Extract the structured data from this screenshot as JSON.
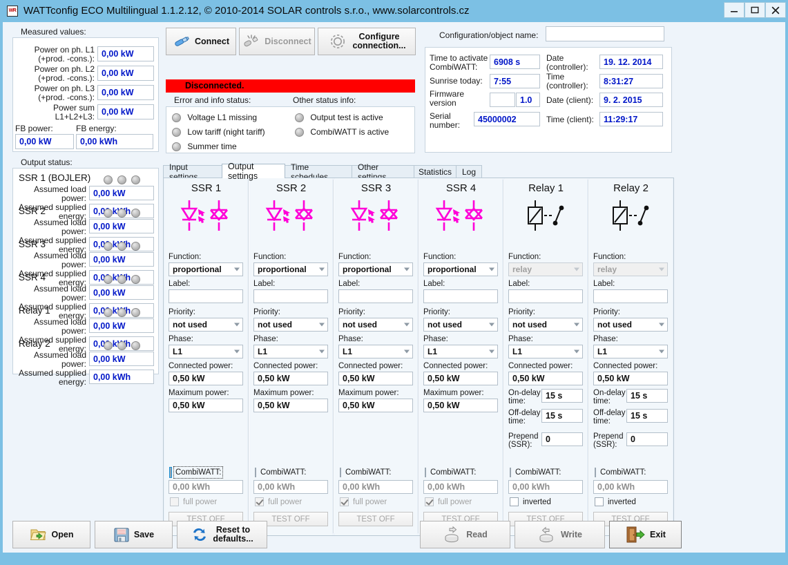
{
  "window": {
    "title": "WATTconfig ECO Multilingual 1.1.2.12, © 2010-2014 SOLAR controls s.r.o., www.solarcontrols.cz",
    "icon_text": "WR",
    "minimize": "—",
    "maximize": "▢",
    "close": "✕"
  },
  "measured": {
    "group_label": "Measured values:",
    "rows": [
      {
        "label1": "Power on ph. L1",
        "label2": "(+prod. -cons.):",
        "value": "0,00 kW"
      },
      {
        "label1": "Power on ph. L2",
        "label2": "(+prod. -cons.):",
        "value": "0,00 kW"
      },
      {
        "label1": "Power on ph. L3",
        "label2": "(+prod. -cons.):",
        "value": "0,00 kW"
      },
      {
        "label1": "Power sum",
        "label2": "L1+L2+L3:",
        "value": "0,00 kW"
      }
    ],
    "fb_power_label": "FB power:",
    "fb_power_value": "0,00 kW",
    "fb_energy_label": "FB energy:",
    "fb_energy_value": "0,00 kWh"
  },
  "connection": {
    "connect": "Connect",
    "disconnect": "Disconnect",
    "configure": "Configure\nconnection...",
    "configure_line1": "Configure",
    "configure_line2": "connection...",
    "status_text": "Disconnected.",
    "status_color": "#ff0000"
  },
  "status": {
    "error_label": "Error and info status:",
    "other_label": "Other status info:",
    "error_items": [
      "Voltage L1 missing",
      "Low tariff (night tariff)",
      "Summer time"
    ],
    "other_items": [
      "Output test is active",
      "CombiWATT is active"
    ]
  },
  "config": {
    "name_label": "Configuration/object name:",
    "name_value": "",
    "fields": [
      {
        "label1": "Time to activate",
        "label2": "CombiWATT:",
        "value": "6908 s"
      },
      {
        "label1": "Sunrise today:",
        "label2": "",
        "value": "7:55"
      },
      {
        "label1": "Firmware",
        "label2": "version",
        "value": "",
        "value2": "1.0"
      },
      {
        "label1": "Serial",
        "label2": "number:",
        "value": "45000002"
      }
    ],
    "right_fields": [
      {
        "label1": "Date",
        "label2": "(controller):",
        "value": "19. 12. 2014"
      },
      {
        "label1": "Time",
        "label2": "(controller):",
        "value": "8:31:27"
      },
      {
        "label1": "Date (client):",
        "label2": "",
        "value": "9. 2. 2015"
      },
      {
        "label1": "Time (client):",
        "label2": "",
        "value": "11:29:17"
      }
    ]
  },
  "output_status": {
    "group_label": "Output status:",
    "load_power_label1": "Assumed load",
    "load_power_label2": "power:",
    "supplied_label1": "Assumed supplied",
    "supplied_label2": "energy:",
    "items": [
      {
        "name": "SSR 1 (BOJLER)",
        "load_power": "0,00 kW",
        "supplied_energy": "0,00 kWh",
        "leds": 4
      },
      {
        "name": "SSR 2",
        "load_power": "0,00 kW",
        "supplied_energy": "0,00 kWh",
        "leds": 4
      },
      {
        "name": "SSR 3",
        "load_power": "0,00 kW",
        "supplied_energy": "0,00 kWh",
        "leds": 4
      },
      {
        "name": "SSR 4",
        "load_power": "0,00 kW",
        "supplied_energy": "0,00 kWh",
        "leds": 4
      },
      {
        "name": "Relay 1",
        "load_power": "0,00 kW",
        "supplied_energy": "0,00 kWh",
        "leds": 4
      },
      {
        "name": "Relay 2",
        "load_power": "0,00 kW",
        "supplied_energy": "0,00 kWh",
        "leds": 4
      }
    ]
  },
  "tabs": {
    "items": [
      "Input settings",
      "Output settings",
      "Time schedules",
      "Other settings",
      "Statistics",
      "Log"
    ],
    "active": "Output settings"
  },
  "output_settings": {
    "labels": {
      "function": "Function:",
      "label": "Label:",
      "priority": "Priority:",
      "phase": "Phase:",
      "connected_power": "Connected power:",
      "maximum_power": "Maximum power:",
      "on_delay1": "On-delay",
      "on_delay2": "time:",
      "off_delay1": "Off-delay",
      "off_delay2": "time:",
      "prepend1": "Prepend",
      "prepend2": "(SSR):",
      "combiwatt": "CombiWATT:",
      "full_power": "full power",
      "inverted": "inverted",
      "test_off": "TEST OFF"
    },
    "columns": [
      {
        "title": "SSR 1",
        "icon": "triac-optocoupler-icon",
        "kind": "ssr",
        "function": "proportional",
        "function_disabled": false,
        "label_value": "",
        "priority": "not used",
        "phase": "L1",
        "connected_power": "0,50 kW",
        "maximum_power": "0,50 kW",
        "combiwatt_checked": false,
        "combiwatt_focused": true,
        "combiwatt_energy": "0,00 kWh",
        "full_power_checked": false,
        "test_off": "TEST OFF"
      },
      {
        "title": "SSR 2",
        "icon": "triac-optocoupler-icon",
        "kind": "ssr",
        "function": "proportional",
        "function_disabled": false,
        "label_value": "",
        "priority": "not used",
        "phase": "L1",
        "connected_power": "0,50 kW",
        "maximum_power": "0,50 kW",
        "combiwatt_checked": false,
        "combiwatt_focused": false,
        "combiwatt_energy": "0,00 kWh",
        "full_power_checked": true,
        "test_off": "TEST OFF"
      },
      {
        "title": "SSR 3",
        "icon": "triac-optocoupler-icon",
        "kind": "ssr",
        "function": "proportional",
        "function_disabled": false,
        "label_value": "",
        "priority": "not used",
        "phase": "L1",
        "connected_power": "0,50 kW",
        "maximum_power": "0,50 kW",
        "combiwatt_checked": false,
        "combiwatt_focused": false,
        "combiwatt_energy": "0,00 kWh",
        "full_power_checked": true,
        "test_off": "TEST OFF"
      },
      {
        "title": "SSR 4",
        "icon": "triac-optocoupler-icon",
        "kind": "ssr",
        "function": "proportional",
        "function_disabled": false,
        "label_value": "",
        "priority": "not used",
        "phase": "L1",
        "connected_power": "0,50 kW",
        "maximum_power": "0,50 kW",
        "combiwatt_checked": false,
        "combiwatt_focused": false,
        "combiwatt_energy": "0,00 kWh",
        "full_power_checked": true,
        "test_off": "TEST OFF"
      },
      {
        "title": "Relay 1",
        "icon": "relay-icon",
        "kind": "relay",
        "function": "relay",
        "function_disabled": true,
        "label_value": "",
        "priority": "not used",
        "phase": "L1",
        "connected_power": "0,50 kW",
        "on_delay": "15 s",
        "off_delay": "15 s",
        "prepend": "0",
        "combiwatt_checked": false,
        "combiwatt_focused": false,
        "combiwatt_energy": "0,00 kWh",
        "inverted_checked": false,
        "test_off": "TEST OFF"
      },
      {
        "title": "Relay 2",
        "icon": "relay-icon",
        "kind": "relay",
        "function": "relay",
        "function_disabled": true,
        "label_value": "",
        "priority": "not used",
        "phase": "L1",
        "connected_power": "0,50 kW",
        "on_delay": "15 s",
        "off_delay": "15 s",
        "prepend": "0",
        "combiwatt_checked": false,
        "combiwatt_focused": false,
        "combiwatt_energy": "0,00 kWh",
        "inverted_checked": false,
        "test_off": "TEST OFF"
      }
    ]
  },
  "footer": {
    "open": "Open",
    "save": "Save",
    "reset_line1": "Reset to",
    "reset_line2": "defaults...",
    "read": "Read",
    "write": "Write",
    "exit": "Exit"
  }
}
